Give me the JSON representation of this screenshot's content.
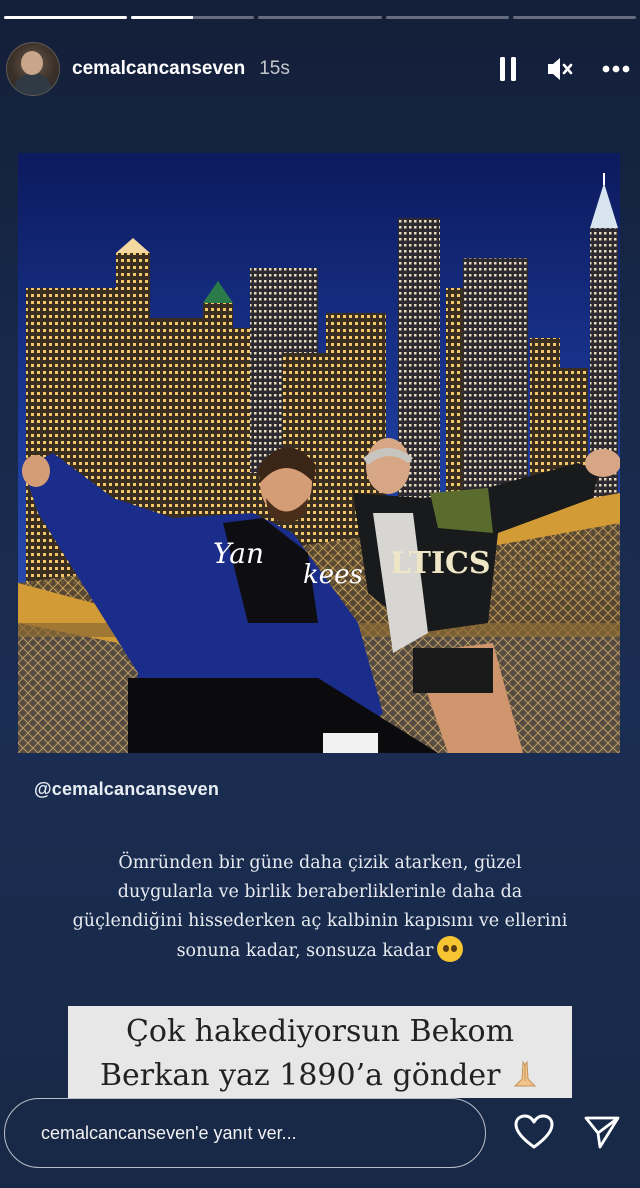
{
  "story": {
    "progress": [
      1.0,
      0.5,
      0,
      0,
      0
    ]
  },
  "header": {
    "username": "cemalcancanseven",
    "time": "15s",
    "icons": [
      "pause-icon",
      "mute-icon",
      "more-icon"
    ]
  },
  "post": {
    "mention": "@cemalcancanseven",
    "caption_lines": [
      "Ömründen bir güne daha çizik atarken, güzel",
      "duygularla ve birlik beraberliklerinle daha da",
      "güçlendiğini hissederken aç kalbinin kapısını ve ellerini",
      "sonuna kadar, sonsuza kadar"
    ],
    "caption_emoji": "pleading-face-icon"
  },
  "banner": {
    "line1": "Çok hakediyorsun Bekom",
    "line2": "Berkan yaz 1890’a gönder",
    "emoji": "praying-hands-icon"
  },
  "reply": {
    "placeholder": "cemalcancanseven'e yanıt ver..."
  },
  "colors": {
    "background": "#16233f",
    "banner_bg": "#e7e7e7",
    "text": "#ffffff"
  }
}
